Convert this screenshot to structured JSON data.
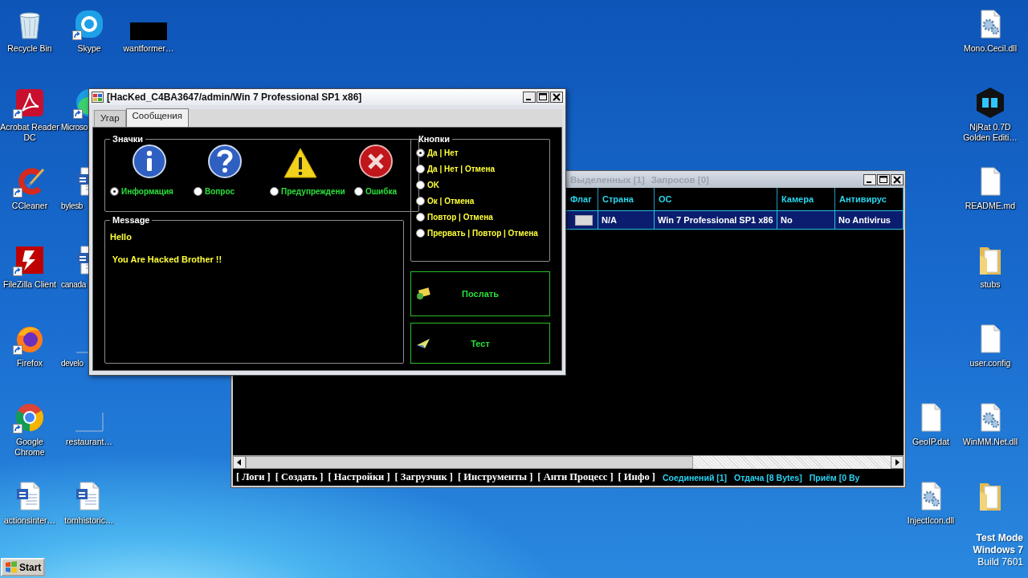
{
  "desktop": {
    "left_columns": [
      [
        {
          "label": "Recycle Bin",
          "kind": "recycle",
          "shortcut": false
        },
        {
          "label": "Acrobat Reader DC",
          "kind": "pdf",
          "shortcut": true
        },
        {
          "label": "CCleaner",
          "kind": "ccleaner",
          "shortcut": true
        },
        {
          "label": "FileZilla Client",
          "kind": "filezilla",
          "shortcut": true
        },
        {
          "label": "Firefox",
          "kind": "firefox",
          "shortcut": true
        },
        {
          "label": "Google Chrome",
          "kind": "chrome",
          "shortcut": true
        },
        {
          "label": "actionsinter…",
          "kind": "word",
          "shortcut": false
        }
      ],
      [
        {
          "label": "Skype",
          "kind": "skype",
          "shortcut": true
        },
        {
          "label": "Microso",
          "kind": "edge",
          "shortcut": true
        },
        {
          "label": "bylesb",
          "kind": "word",
          "shortcut": false
        },
        {
          "label": "canada",
          "kind": "word",
          "shortcut": false
        },
        {
          "label": "develo",
          "kind": "outline",
          "shortcut": false
        },
        {
          "label": "restaurant…",
          "kind": "outline",
          "shortcut": false
        },
        {
          "label": "tomhistoric…",
          "kind": "word",
          "shortcut": false
        }
      ],
      [
        {
          "label": "wantformer…",
          "kind": "blackbox",
          "shortcut": false
        }
      ]
    ],
    "right_columns": [
      [
        {
          "label": "GeoIP.dat",
          "kind": "file",
          "shortcut": false
        },
        {
          "label": "InjectIcon.dll",
          "kind": "gears",
          "shortcut": false
        }
      ],
      [
        {
          "label": "Mono.Cecil.dll",
          "kind": "gears",
          "shortcut": false
        },
        {
          "label": "NjRat 0.7D Golden Editi…",
          "kind": "njrat",
          "shortcut": false
        },
        {
          "label": "README.md",
          "kind": "file",
          "shortcut": false
        },
        {
          "label": "stubs",
          "kind": "folder",
          "shortcut": false
        },
        {
          "label": "user.config",
          "kind": "file",
          "shortcut": false
        },
        {
          "label": "WinMM.Net.dll",
          "kind": "gears",
          "shortcut": false
        },
        {
          "kind": "folder",
          "shortcut": false
        }
      ]
    ],
    "os_info": [
      "Test Mode",
      "Windows 7",
      "Build 7601"
    ]
  },
  "clients_window": {
    "title_items": [
      "Выделенных [1]",
      "Запросов [0]"
    ],
    "columns": [
      "Флаг",
      "Страна",
      "ОС",
      "Камера",
      "Антивирус"
    ],
    "rows": [
      {
        "selected": true,
        "cells": [
          "",
          "N/A",
          "Win 7 Professional SP1 x86",
          "No",
          "No Antivirus"
        ]
      }
    ],
    "menu": [
      "[ Логи ]",
      "[ Создать ]",
      "[ Настройки ]",
      "[ Загрузчик ]",
      "[ Инструменты ]",
      "[ Анти Процесс ]",
      "[ Инфо ]"
    ],
    "counters": [
      "Соединений [1]",
      "Отдача [8 Bytes]",
      "Приём [0 By"
    ]
  },
  "messages_window": {
    "title": "[HacKed_C4BA3647/admin/Win 7 Professional SP1 x86]",
    "tabs": [
      {
        "label": "Угар",
        "selected": false
      },
      {
        "label": "Сообщения",
        "selected": true
      }
    ],
    "icons_group": {
      "title": "Значки",
      "options": [
        {
          "label": "Информация",
          "kind": "info",
          "selected": true
        },
        {
          "label": "Вопрос",
          "kind": "question",
          "selected": false
        },
        {
          "label": "Предупреждени",
          "kind": "warning",
          "selected": false
        },
        {
          "label": "Ошибка",
          "kind": "error",
          "selected": false
        }
      ]
    },
    "message_group": {
      "title": "Message",
      "text": "Hello\n\n You Are Hacked Brother !!"
    },
    "buttons_group": {
      "title": "Кнопки",
      "options": [
        {
          "label": "Да | Нет",
          "selected": true
        },
        {
          "label": "Да | Нет | Отмена",
          "selected": false
        },
        {
          "label": "OK",
          "selected": false
        },
        {
          "label": "Ок | Отмена",
          "selected": false
        },
        {
          "label": "Повтор | Отмена",
          "selected": false
        },
        {
          "label": "Прервать | Повтор | Отмена",
          "selected": false
        }
      ]
    },
    "actions": [
      {
        "label": "Послать",
        "kind": "send"
      },
      {
        "label": "Тест",
        "kind": "test"
      }
    ]
  },
  "start_button": {
    "label": "Start"
  }
}
